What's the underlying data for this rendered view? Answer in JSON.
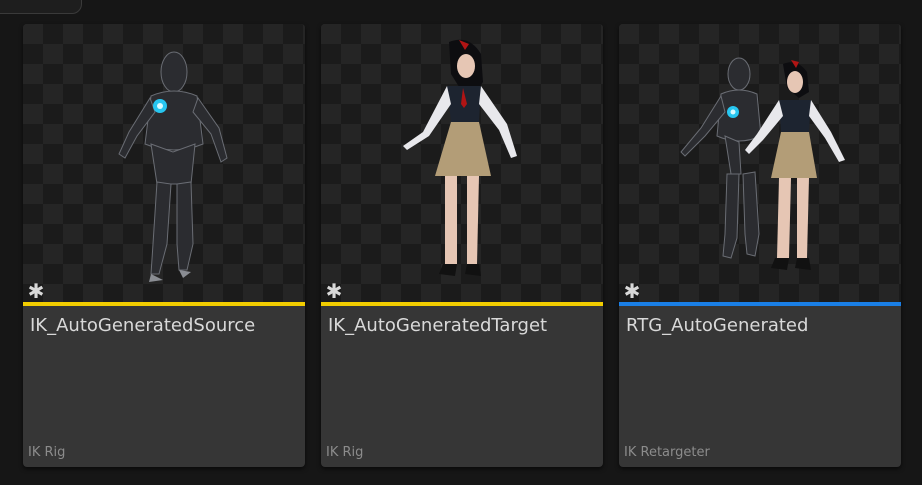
{
  "assets": [
    {
      "name": "IK_AutoGeneratedSource",
      "type": "IK Rig",
      "bar_color": "#f2cd00",
      "thumbnail_icon": "robot-mannequin-thumbnail",
      "badge_icon": "asterisk-badge-icon"
    },
    {
      "name": "IK_AutoGeneratedTarget",
      "type": "IK Rig",
      "bar_color": "#f2cd00",
      "thumbnail_icon": "schoolgirl-character-thumbnail",
      "badge_icon": "asterisk-badge-icon"
    },
    {
      "name": "RTG_AutoGenerated",
      "type": "IK Retargeter",
      "bar_color": "#1a7fe6",
      "thumbnail_icon": "retarget-pair-thumbnail",
      "badge_icon": "asterisk-badge-icon"
    }
  ],
  "badge_glyph": "✱"
}
